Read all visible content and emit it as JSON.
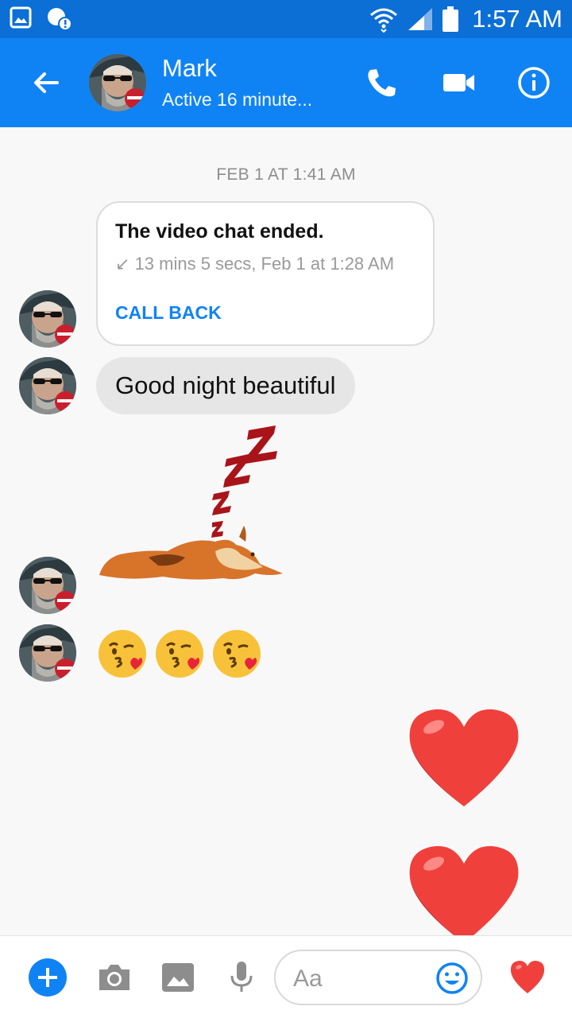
{
  "status_bar": {
    "time": "1:57 AM",
    "icons": [
      "gallery-icon",
      "notification-icon",
      "wifi-icon",
      "signal-icon",
      "battery-icon"
    ]
  },
  "header": {
    "contact_name": "Mark",
    "activity": "Active 16 minute...",
    "icons": [
      "back-arrow-icon",
      "phone-icon",
      "video-camera-icon",
      "info-icon"
    ]
  },
  "chat": {
    "date_stamp": "FEB 1 AT 1:41 AM",
    "call_card": {
      "title": "The video chat ended.",
      "detail": "13 mins 5 secs, Feb 1 at 1:28 AM",
      "action": "CALL BACK"
    },
    "message_text": "Good night beautiful",
    "sticker": "sleeping-dog-zzz",
    "emoji_count": 3,
    "sent_hearts": 2
  },
  "composer": {
    "placeholder": "Aa",
    "icons": [
      "plus-icon",
      "camera-icon",
      "image-icon",
      "microphone-icon",
      "smiley-icon",
      "heart-icon"
    ]
  },
  "colors": {
    "brand_blue": "#1083f4",
    "status_blue": "#0b6fd6",
    "heart_red": "#f0403c",
    "emoji_yellow": "#f7c23a"
  }
}
